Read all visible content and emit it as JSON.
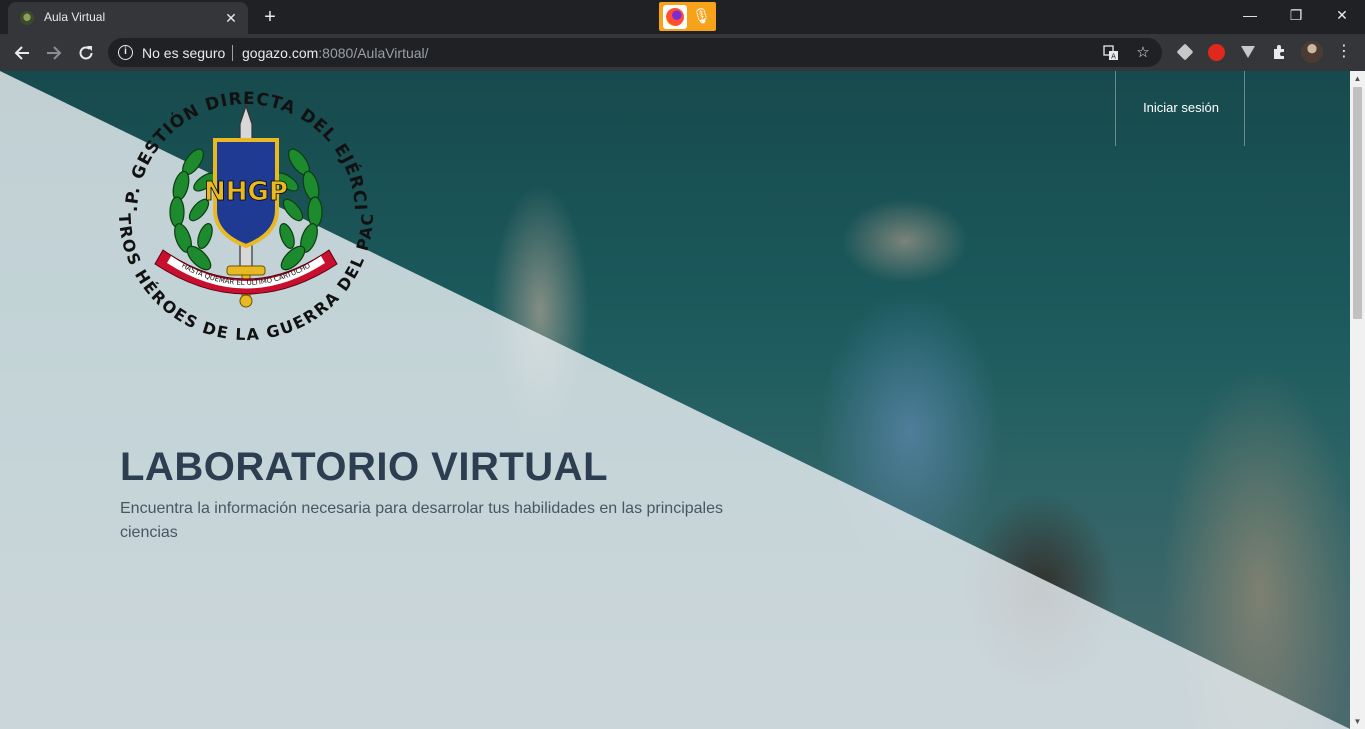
{
  "browser": {
    "tab_title": "Aula Virtual",
    "close_glyph": "✕",
    "newtab_glyph": "+",
    "security_label": "No es seguro",
    "url_host": "gogazo.com",
    "url_rest": ":8080/AulaVirtual/",
    "window_controls": {
      "minimize": "—",
      "restore": "❐",
      "close": "✕"
    }
  },
  "header": {
    "login_label": "Iniciar sesión"
  },
  "logo": {
    "top_text": "I.E.P. GESTIÓN DIRECTA DEL EJÉRCITO",
    "bottom_text": "NUESTROS HÉROES DE LA GUERRA DEL PACÍFICO",
    "ribbon_text": "HASTA QUEMAR EL ÚLTIMO CARTUCHO",
    "shield_letters": "NHGP"
  },
  "hero": {
    "title": "LABORATORIO VIRTUAL",
    "subtitle": "Encuentra la información necesaria para desarrolar tus habilidades en las principales ciencias"
  },
  "colors": {
    "chrome_dark": "#202124",
    "chrome_toolbar": "#35363a",
    "hero_title": "#2c3e50",
    "shield_blue": "#1f3a93",
    "shield_gold": "#e8b923",
    "laurel_green": "#1e8a2e",
    "ribbon_red": "#c8102e"
  }
}
